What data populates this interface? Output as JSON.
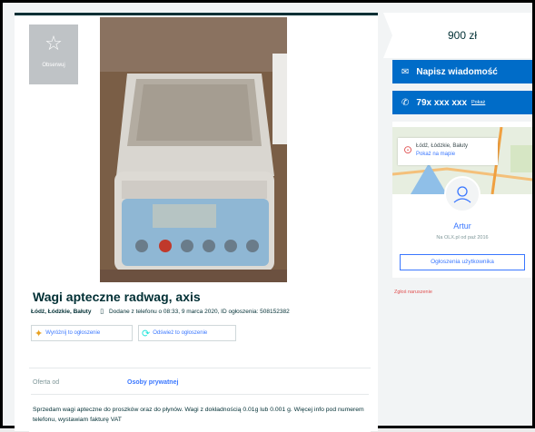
{
  "listing": {
    "observe_label": "Obserwuj",
    "title": "Wagi apteczne radwag, axis",
    "location": "Łódź, Łódzkie, Bałuty",
    "added": "Dodane z telefonu",
    "time": "o 08:33, 9 marca 2020, ID ogłoszenia: 508152382",
    "promote_label": "Wyróżnij to ogłoszenie",
    "refresh_label": "Odśwież to ogłoszenie",
    "attribute_key": "Oferta od",
    "attribute_value": "Osoby prywatnej",
    "description": "Sprzedam wagi apteczne do proszków oraz do płynów. Wagi z dokładnością 0.01g lub 0.001 g. Więcej info pod numerem telefonu, wystawiam fakturę VAT"
  },
  "sidebar": {
    "price": "900 zł",
    "message_label": "Napisz wiadomość",
    "phone_masked": "79x xxx xxx",
    "phone_show": "Pokaż",
    "map_location": "Łódź, Łódzkie, Bałuty",
    "map_show": "Pokaż na mapie",
    "seller_name": "Artur",
    "seller_since": "Na OLX.pl od paź 2016",
    "user_ads_label": "Ogłoszenia użytkownika",
    "report_label": "Zgłoś naruszenie"
  },
  "colors": {
    "brand_dark": "#002f34",
    "button_blue": "#006cc8",
    "link_blue": "#3a77ff",
    "report_red": "#e05050"
  },
  "icons": {
    "observe": "star-icon",
    "message": "envelope-icon",
    "phone": "phone-icon",
    "location": "map-pin-icon",
    "avatar": "user-icon",
    "promote": "kite-icon",
    "refresh": "refresh-icon"
  }
}
